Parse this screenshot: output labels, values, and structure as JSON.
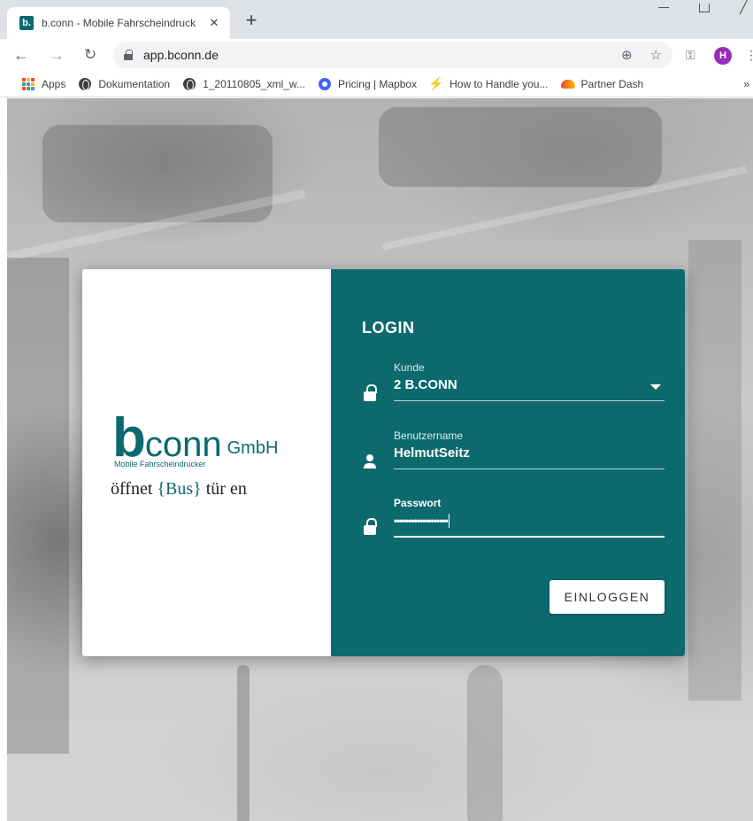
{
  "browser": {
    "tab_title": "b.conn - Mobile Fahrscheindruck",
    "tab_close": "✕",
    "new_tab": "+",
    "favicon_letter": "b.",
    "url": "app.bconn.de",
    "avatar_initial": "H",
    "bookmarks": [
      {
        "label": "Apps",
        "icon": "apps-grid-icon"
      },
      {
        "label": "Dokumentation",
        "icon": "globe-icon"
      },
      {
        "label": "1_20110805_xml_w...",
        "icon": "globe-icon"
      },
      {
        "label": "Pricing | Mapbox",
        "icon": "mapbox-icon"
      },
      {
        "label": "How to Handle you...",
        "icon": "bolt-icon"
      },
      {
        "label": "Partner Dash",
        "icon": "partner-icon"
      }
    ],
    "bookmarks_more": "»"
  },
  "brand": {
    "logo_b": "b",
    "logo_conn": "conn",
    "logo_gmbh": "GmbH",
    "logo_sub": "Mobile Fahrscheindrucker",
    "slogan_prefix": "öffnet ",
    "slogan_bus": "{Bus}",
    "slogan_suffix": "tür en",
    "color": "#0c6a6e"
  },
  "login": {
    "title": "LOGIN",
    "kunde_label": "Kunde",
    "kunde_value": "2 B.CONN",
    "username_label": "Benutzername",
    "username_value": "HelmutSeitz",
    "password_label": "Passwort",
    "password_value": "•••••••••••••••••••",
    "submit_label": "EINLOGGEN"
  }
}
